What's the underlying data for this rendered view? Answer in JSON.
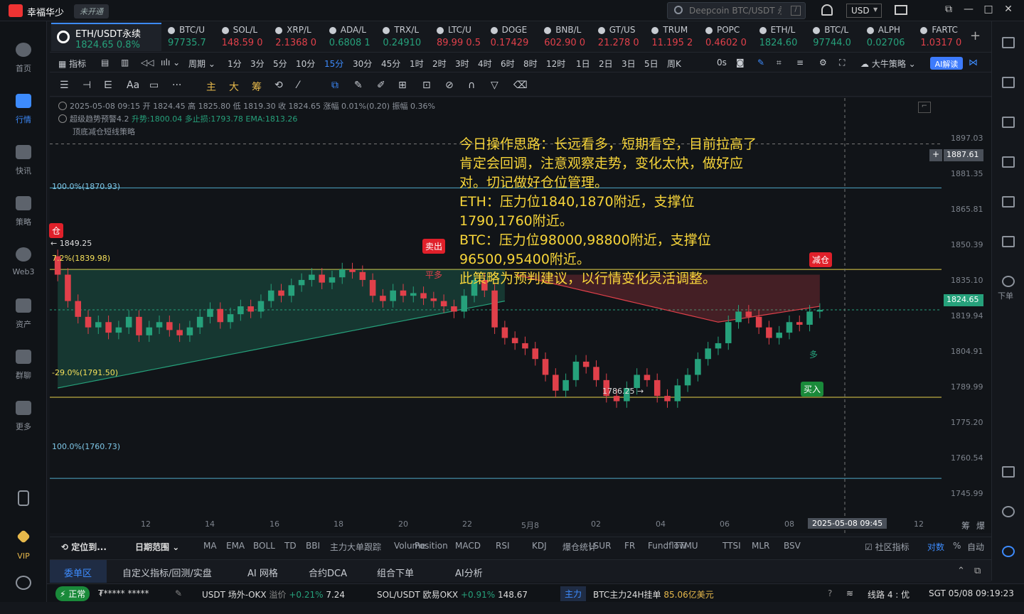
{
  "app": {
    "name": "幸福华少",
    "open_status": "未开通"
  },
  "search": {
    "placeholder": "Deepcoin BTC/USDT 永续",
    "shortcut": "/"
  },
  "currency": "USD",
  "window": {
    "restore": "⧉",
    "minimize": "—",
    "maximize": "□",
    "close": "✕"
  },
  "left_nav": [
    {
      "label": "首页"
    },
    {
      "label": "行情"
    },
    {
      "label": "快讯"
    },
    {
      "label": "策略"
    },
    {
      "label": "Web3"
    },
    {
      "label": "资产"
    },
    {
      "label": "群聊"
    },
    {
      "label": "更多"
    },
    {
      "label": "VIP"
    }
  ],
  "main_tab": {
    "symbol": "ETH/USDT永续",
    "price": "1824.65",
    "change": "0.8%"
  },
  "tabs": [
    {
      "symbol": "BTC/U",
      "price": "97735.7",
      "dir": "up"
    },
    {
      "symbol": "SOL/L",
      "price": "148.59 0",
      "dir": "dn"
    },
    {
      "symbol": "XRP/L",
      "price": "2.1368 0",
      "dir": "dn"
    },
    {
      "symbol": "ADA/L",
      "price": "0.6808 1",
      "dir": "up"
    },
    {
      "symbol": "TRX/L",
      "price": "0.24910",
      "dir": "up"
    },
    {
      "symbol": "LTC/U",
      "price": "89.99 0.5",
      "dir": "dn"
    },
    {
      "symbol": "DOGE",
      "price": "0.17429",
      "dir": "dn"
    },
    {
      "symbol": "BNB/L",
      "price": "602.90 0",
      "dir": "dn"
    },
    {
      "symbol": "GT/US",
      "price": "21.278 0",
      "dir": "dn"
    },
    {
      "symbol": "TRUM",
      "price": "11.195 2",
      "dir": "dn"
    },
    {
      "symbol": "POPC",
      "price": "0.4602 0",
      "dir": "dn"
    },
    {
      "symbol": "ETH/L",
      "price": "1824.60",
      "dir": "up"
    },
    {
      "symbol": "BTC/L",
      "price": "97744.0",
      "dir": "up"
    },
    {
      "symbol": "ALPH",
      "price": "0.02706",
      "dir": "up"
    },
    {
      "symbol": "FARTC",
      "price": "1.0317 0",
      "dir": "dn"
    }
  ],
  "toolbar": {
    "indicators": "指标",
    "period": "周期",
    "intervals": [
      "1分",
      "3分",
      "5分",
      "10分",
      "15分",
      "30分",
      "45分",
      "1时",
      "2时",
      "3时",
      "4时",
      "6时",
      "8时",
      "12时",
      "1日",
      "2日",
      "3日",
      "5日",
      "周K"
    ],
    "selected_interval": "15分",
    "zero_s": "0s",
    "strategy": "大牛策略",
    "ai": "AI解读"
  },
  "draw_tools": [
    "主",
    "大",
    "筹"
  ],
  "legend": {
    "line1": "2025-05-08 09:15  开 1824.45  高 1825.80  低 1819.30  收 1824.65  涨幅 0.01%(0.20)  振幅 0.36%",
    "line2_name": "超级趋势预警4.2",
    "line2_vals": "升势:1800.04  多止损:1793.78  EMA:1813.26",
    "line3": "顶底减仓短线策略"
  },
  "note": [
    "今日操作思路：长远看多，短期看空，目前拉高了肯定会回调，注意观察走势，变化太快，做好应对。切记做好仓位管理。",
    "ETH：压力位1840,1870附近，支撑位1790,1760附近。",
    "BTC：压力位98000,98800附近，支撑位96500,95400附近。",
    "此策略为预判建议，以行情变化灵活调整。"
  ],
  "price_axis": [
    "1897.03",
    "1881.35",
    "1865.81",
    "1850.39",
    "1835.10",
    "1819.94",
    "1804.91",
    "1789.99",
    "1775.20",
    "1760.54",
    "1745.99"
  ],
  "crosshair_price": "1887.61",
  "last_price": "1824.65",
  "fib": {
    "top": "100.0%(1870.93)",
    "mid": "7.2%(1839.98)",
    "low": "-29.0%(1791.50)",
    "bottom": "100.0%(1760.73)"
  },
  "marks": {
    "high": "1849.25",
    "low": "1786.25",
    "sell": "卖出",
    "flat_long": "平多",
    "reduce": "减仓",
    "reduce_left": "仓",
    "buy": "买入",
    "long": "多"
  },
  "x_axis": [
    "12",
    "14",
    "16",
    "18",
    "20",
    "22",
    "5月8",
    "02",
    "04",
    "06",
    "08",
    "12"
  ],
  "crosshair_time": "2025-05-08 09:45",
  "axis_buttons": [
    "筹",
    "爆"
  ],
  "indicator_bar": {
    "locate": "定位到...",
    "range": "日期范围",
    "items": [
      "MA",
      "EMA",
      "BOLL",
      "TD",
      "BBI",
      "主力大单跟踪",
      "Volume",
      "Position",
      "MACD",
      "RSI",
      "KDJ",
      "爆仓统计",
      "LSUR",
      "FR",
      "Fundflow",
      "TTMU",
      "TTSI",
      "MLR",
      "BSV"
    ],
    "community": "社区指标",
    "log": "对数",
    "percent": "%",
    "auto": "自动"
  },
  "bottom_tabs": [
    "委单区",
    "自定义指标/回测/实盘",
    "AI 网格",
    "合约DCA",
    "组合下单",
    "AI分析"
  ],
  "status": {
    "normal": "正常",
    "user": "₮***** *****",
    "usdt": "USDT 场外-OKX",
    "usdt_prem_lbl": "溢价",
    "usdt_prem": "+0.21%",
    "usdt_val": "7.24",
    "sol": "SOL/USDT 欧易OKX",
    "sol_chg": "+0.91%",
    "sol_val": "148.67",
    "main_lbl": "主力",
    "btc_text": "BTC主力24H挂单",
    "btc_val": "85.06亿美元",
    "line": "线路 4 : 优",
    "time": "SGT  05/08 09:19:23"
  },
  "colors": {
    "up": "#26a17b",
    "down": "#e0404a",
    "accent": "#3d8bfd",
    "note": "#f7d53a"
  },
  "chart_data": {
    "type": "candlestick",
    "symbol": "ETH/USDT永续",
    "interval": "15分",
    "ylim": [
      1740,
      1905
    ],
    "open": [
      1845,
      1838,
      1828,
      1822,
      1818,
      1820,
      1816,
      1818,
      1822,
      1815,
      1818,
      1820,
      1817,
      1815,
      1818,
      1822,
      1825,
      1820,
      1823,
      1826,
      1824,
      1828,
      1832,
      1830,
      1834,
      1836,
      1838,
      1835,
      1837,
      1840,
      1839,
      1836,
      1830,
      1828,
      1832,
      1830,
      1831,
      1829,
      1828,
      1826,
      1824,
      1830,
      1836,
      1832,
      1818,
      1814,
      1812,
      1810,
      1806,
      1800,
      1794,
      1798,
      1805,
      1803,
      1798,
      1792,
      1790,
      1795,
      1800,
      1798,
      1792,
      1790,
      1796,
      1800,
      1806,
      1810,
      1812,
      1820,
      1824,
      1822,
      1818,
      1814,
      1816,
      1820,
      1819,
      1824
    ],
    "close": [
      1838,
      1828,
      1822,
      1818,
      1820,
      1816,
      1818,
      1822,
      1815,
      1818,
      1820,
      1817,
      1815,
      1818,
      1822,
      1825,
      1820,
      1823,
      1826,
      1824,
      1828,
      1832,
      1830,
      1834,
      1836,
      1838,
      1835,
      1837,
      1840,
      1839,
      1836,
      1830,
      1828,
      1832,
      1830,
      1831,
      1829,
      1828,
      1826,
      1824,
      1830,
      1836,
      1832,
      1818,
      1814,
      1812,
      1810,
      1806,
      1800,
      1794,
      1798,
      1805,
      1803,
      1798,
      1792,
      1790,
      1795,
      1800,
      1798,
      1792,
      1790,
      1796,
      1800,
      1806,
      1810,
      1812,
      1820,
      1824,
      1822,
      1818,
      1814,
      1816,
      1820,
      1819,
      1824,
      1824.65
    ]
  }
}
